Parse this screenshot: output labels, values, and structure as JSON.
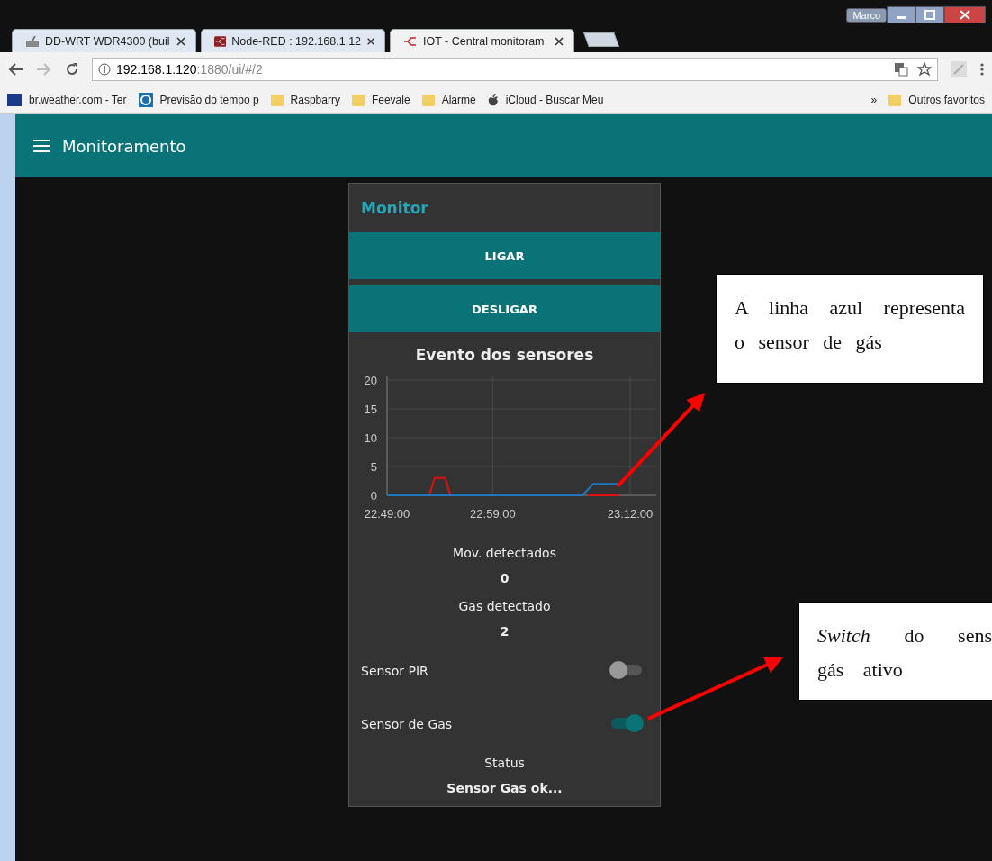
{
  "window": {
    "user": "Marco"
  },
  "tabs": [
    {
      "label": "DD-WRT WDR4300 (buil",
      "selected": false,
      "kind": "ddwrt"
    },
    {
      "label": "Node-RED : 192.168.1.12",
      "selected": false,
      "kind": "nodered"
    },
    {
      "label": "IOT - Central monitoram",
      "selected": true,
      "kind": "flow"
    }
  ],
  "address_bar": {
    "host": "192.168.1.120",
    "path": ":1880/ui/#/2"
  },
  "bookmarks": [
    {
      "label": "br.weather.com - Ter",
      "kind": "twc"
    },
    {
      "label": "Previsão do tempo p",
      "kind": "circle"
    },
    {
      "label": "Raspbarry",
      "kind": "folder"
    },
    {
      "label": "Feevale",
      "kind": "folder"
    },
    {
      "label": "Alarme",
      "kind": "folder"
    },
    {
      "label": "iCloud - Buscar Meu",
      "kind": "apple"
    }
  ],
  "bookmarks_more": "»",
  "other_bookmarks": "Outros favoritos",
  "app_header": {
    "title": "Monitoramento"
  },
  "card": {
    "title": "Monitor",
    "buttons": [
      "LIGAR",
      "DESLIGAR"
    ],
    "chart_data": {
      "type": "line",
      "title": "Evento dos sensores",
      "categories": [
        "22:49:00",
        null,
        null,
        null,
        null,
        null,
        null,
        null,
        null,
        null,
        null,
        null,
        null,
        null,
        null,
        null,
        null,
        null,
        null,
        null,
        "22:59:00",
        null,
        null,
        null,
        null,
        null,
        null,
        null,
        null,
        null,
        null,
        null,
        null,
        null,
        null,
        null,
        null,
        null,
        null,
        null,
        null,
        null,
        null,
        null,
        null,
        null,
        "23:12:00"
      ],
      "series": [
        {
          "color": "#e01010",
          "values": [
            null,
            null,
            null,
            null,
            null,
            null,
            null,
            null,
            0,
            3,
            3,
            3,
            0,
            null,
            null,
            null,
            null,
            null,
            null,
            null,
            null,
            null,
            null,
            null,
            null,
            null,
            null,
            null,
            null,
            null,
            null,
            null,
            null,
            null,
            null,
            null,
            null,
            null,
            0,
            0,
            0,
            0,
            0,
            0,
            0,
            null,
            null
          ]
        },
        {
          "color": "#1f78c1",
          "values": [
            0,
            0,
            0,
            0,
            0,
            0,
            0,
            0,
            0,
            0,
            0,
            0,
            0,
            0,
            0,
            0,
            0,
            0,
            0,
            0,
            0,
            0,
            0,
            0,
            0,
            0,
            0,
            0,
            0,
            0,
            0,
            0,
            0,
            0,
            0,
            0,
            0,
            0,
            1,
            2,
            2,
            2,
            2,
            2,
            2,
            null,
            null
          ]
        }
      ],
      "ylim": [
        0,
        20
      ],
      "yticks": [
        0,
        5,
        10,
        15,
        20
      ],
      "grid": true
    },
    "readings": [
      {
        "label": "Mov. detectados",
        "value": "0"
      },
      {
        "label": "Gas detectado",
        "value": "2"
      }
    ],
    "switches": [
      {
        "label": "Sensor PIR",
        "on": false
      },
      {
        "label": "Sensor de Gas",
        "on": true
      }
    ],
    "status": {
      "label": "Status",
      "value": "Sensor Gas ok..."
    }
  },
  "annotations": [
    {
      "text": "A linha azul representa o sensor de gás"
    },
    {
      "text": "*Switch* do sens gás ativo"
    }
  ]
}
